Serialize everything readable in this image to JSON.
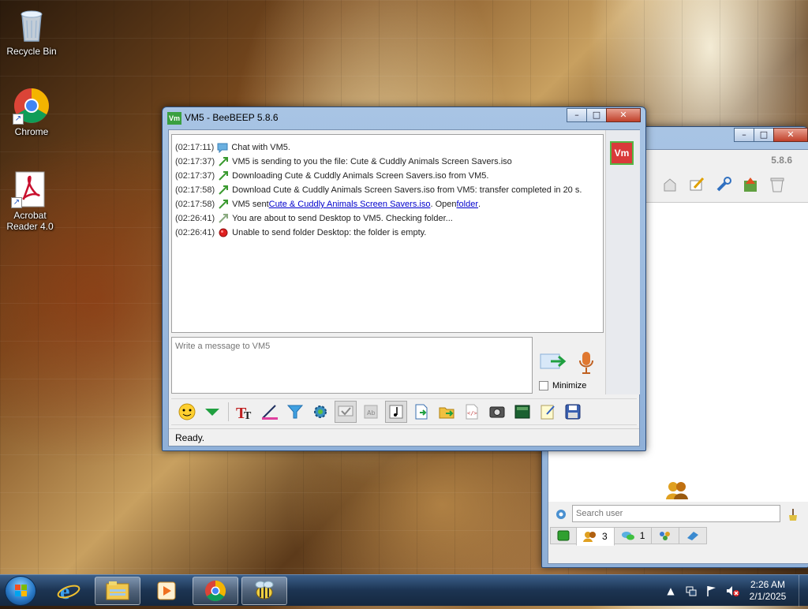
{
  "desktop": {
    "icons": [
      {
        "label": "Recycle Bin",
        "icon": "recycle-bin-icon"
      },
      {
        "label": "Chrome",
        "icon": "chrome-icon"
      },
      {
        "label": "Acrobat Reader 4.0",
        "icon": "acrobat-icon"
      }
    ]
  },
  "chat_window": {
    "title": "VM5 - BeeBEEP 5.8.6",
    "title_icon_text": "Vm",
    "caption_buttons": {
      "minimize": "–",
      "maximize": "□",
      "close": "✕"
    },
    "avatar_text": "Vm",
    "messages": [
      {
        "time": "(02:17:11)",
        "icon": "chat-bubble-icon",
        "text": "Chat with VM5."
      },
      {
        "time": "(02:17:37)",
        "icon": "file-transfer-icon",
        "text": "VM5 is sending to you the file: Cute & Cuddly Animals Screen Savers.iso"
      },
      {
        "time": "(02:17:37)",
        "icon": "file-transfer-icon",
        "text": "Downloading Cute & Cuddly Animals Screen Savers.iso from VM5."
      },
      {
        "time": "(02:17:58)",
        "icon": "file-transfer-icon",
        "text": "Download Cute & Cuddly Animals Screen Savers.iso from VM5: transfer completed in 20 s."
      },
      {
        "time": "(02:17:58)",
        "icon": "file-transfer-icon",
        "text_before": "VM5 sent ",
        "link_file": "Cute & Cuddly Animals Screen Savers.iso",
        "text_middle": ". Open ",
        "link_folder": "folder",
        "text_after": "."
      },
      {
        "time": "(02:26:41)",
        "icon": "file-transfer-icon",
        "text": "You are about to send Desktop to VM5. Checking folder..."
      },
      {
        "time": "(02:26:41)",
        "icon": "error-dot-icon",
        "text": "Unable to send folder Desktop: the folder is empty."
      }
    ],
    "compose_placeholder": "Write a message to VM5",
    "minimize_label": "Minimize",
    "status": "Ready.",
    "colors": {
      "accent_link": "#0000cc",
      "avatar_bg": "#d93a3a",
      "avatar_border": "#55b545"
    }
  },
  "main_window": {
    "version": "5.8.6",
    "search_placeholder": "Search user",
    "tabs": [
      {
        "icon": "users-tab-icon",
        "count": ""
      },
      {
        "icon": "group-tab-icon",
        "count": "3"
      },
      {
        "icon": "chats-tab-icon",
        "count": "1"
      },
      {
        "icon": "groups-tab-icon",
        "count": ""
      },
      {
        "icon": "share-tab-icon",
        "count": ""
      }
    ]
  },
  "taskbar": {
    "time": "2:26 AM",
    "date": "2/1/2025"
  }
}
